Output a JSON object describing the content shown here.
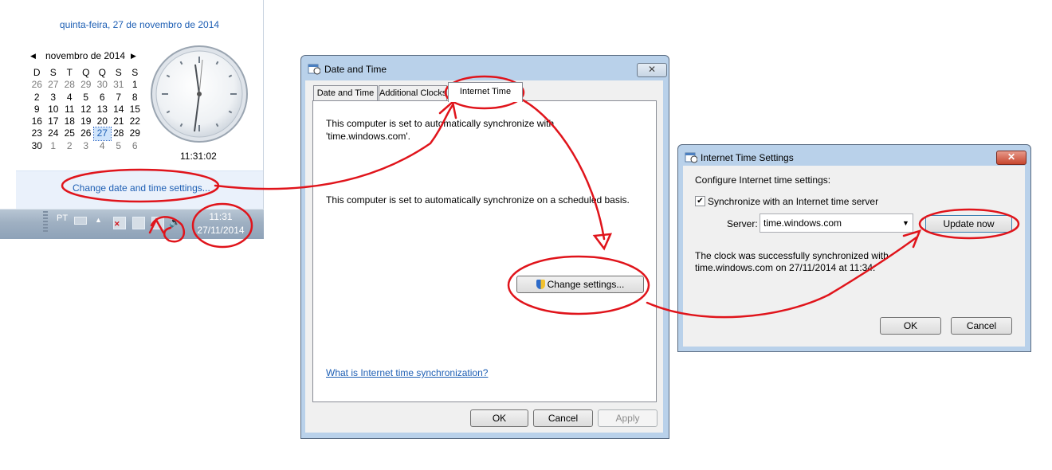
{
  "flyout": {
    "date_header": "quinta-feira, 27 de novembro de 2014",
    "month_label": "novembro de 2014",
    "weekdays": [
      "D",
      "S",
      "T",
      "Q",
      "Q",
      "S",
      "S"
    ],
    "weeks": [
      [
        "26",
        "27",
        "28",
        "29",
        "30",
        "31",
        "1"
      ],
      [
        "2",
        "3",
        "4",
        "5",
        "6",
        "7",
        "8"
      ],
      [
        "9",
        "10",
        "11",
        "12",
        "13",
        "14",
        "15"
      ],
      [
        "16",
        "17",
        "18",
        "19",
        "20",
        "21",
        "22"
      ],
      [
        "23",
        "24",
        "25",
        "26",
        "27",
        "28",
        "29"
      ],
      [
        "30",
        "1",
        "2",
        "3",
        "4",
        "5",
        "6"
      ]
    ],
    "selected_day": "27",
    "clock_time": "11:31:02",
    "change_link": "Change date and time settings..."
  },
  "taskbar": {
    "language": "PT",
    "time": "11:31",
    "date": "27/11/2014"
  },
  "date_time_dialog": {
    "title": "Date and Time",
    "tabs": [
      "Date and Time",
      "Additional Clocks",
      "Internet Time"
    ],
    "active_tab": "Internet Time",
    "sync_text": "This computer is set to automatically synchronize with 'time.windows.com'.",
    "schedule_text": "This computer is set to automatically synchronize on a scheduled basis.",
    "change_settings_label": "Change settings...",
    "help_link": "What is Internet time synchronization?",
    "ok_label": "OK",
    "cancel_label": "Cancel",
    "apply_label": "Apply"
  },
  "internet_time_dialog": {
    "title": "Internet Time Settings",
    "configure_label": "Configure Internet time settings:",
    "sync_checkbox_label": "Synchronize with an Internet time server",
    "sync_checked": true,
    "server_label": "Server:",
    "server_value": "time.windows.com",
    "update_now_label": "Update now",
    "status_message": "The clock was successfully synchronized with time.windows.com on 27/11/2014 at 11:34.",
    "ok_label": "OK",
    "cancel_label": "Cancel"
  },
  "colors": {
    "link": "#1e5fb4",
    "annotation": "#e0141b",
    "window_frame": "#b9d1ea"
  }
}
